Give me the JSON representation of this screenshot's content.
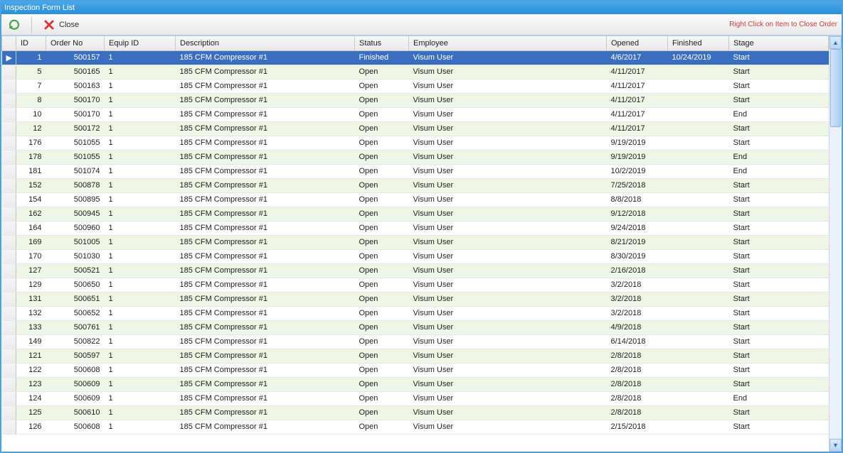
{
  "window": {
    "title": "Inspection Form List"
  },
  "toolbar": {
    "refresh_icon": "refresh-icon",
    "close_label": "Close",
    "hint": "Right Click on Item to Close Order"
  },
  "columns": {
    "rowhead": "",
    "id": "ID",
    "order_no": "Order No",
    "equip_id": "Equip ID",
    "description": "Description",
    "status": "Status",
    "employee": "Employee",
    "opened": "Opened",
    "finished": "Finished",
    "stage": "Stage"
  },
  "rows": [
    {
      "id": "1",
      "order_no": "500157",
      "equip_id": "1",
      "description": "185 CFM Compressor #1",
      "status": "Finished",
      "employee": "Visum User",
      "opened": "4/6/2017",
      "finished": "10/24/2019",
      "stage": "Start",
      "selected": true
    },
    {
      "id": "5",
      "order_no": "500165",
      "equip_id": "1",
      "description": "185 CFM Compressor #1",
      "status": "Open",
      "employee": "Visum User",
      "opened": "4/11/2017",
      "finished": "",
      "stage": "Start"
    },
    {
      "id": "7",
      "order_no": "500163",
      "equip_id": "1",
      "description": "185 CFM Compressor #1",
      "status": "Open",
      "employee": "Visum User",
      "opened": "4/11/2017",
      "finished": "",
      "stage": "Start"
    },
    {
      "id": "8",
      "order_no": "500170",
      "equip_id": "1",
      "description": "185 CFM Compressor #1",
      "status": "Open",
      "employee": "Visum User",
      "opened": "4/11/2017",
      "finished": "",
      "stage": "Start"
    },
    {
      "id": "10",
      "order_no": "500170",
      "equip_id": "1",
      "description": "185 CFM Compressor #1",
      "status": "Open",
      "employee": "Visum User",
      "opened": "4/11/2017",
      "finished": "",
      "stage": "End"
    },
    {
      "id": "12",
      "order_no": "500172",
      "equip_id": "1",
      "description": "185 CFM Compressor #1",
      "status": "Open",
      "employee": "Visum User",
      "opened": "4/11/2017",
      "finished": "",
      "stage": "Start"
    },
    {
      "id": "176",
      "order_no": "501055",
      "equip_id": "1",
      "description": "185 CFM Compressor #1",
      "status": "Open",
      "employee": "Visum User",
      "opened": "9/19/2019",
      "finished": "",
      "stage": "Start"
    },
    {
      "id": "178",
      "order_no": "501055",
      "equip_id": "1",
      "description": "185 CFM Compressor #1",
      "status": "Open",
      "employee": "Visum User",
      "opened": "9/19/2019",
      "finished": "",
      "stage": "End"
    },
    {
      "id": "181",
      "order_no": "501074",
      "equip_id": "1",
      "description": "185 CFM Compressor #1",
      "status": "Open",
      "employee": "Visum User",
      "opened": "10/2/2019",
      "finished": "",
      "stage": "End"
    },
    {
      "id": "152",
      "order_no": "500878",
      "equip_id": "1",
      "description": "185 CFM Compressor #1",
      "status": "Open",
      "employee": "Visum User",
      "opened": "7/25/2018",
      "finished": "",
      "stage": "Start"
    },
    {
      "id": "154",
      "order_no": "500895",
      "equip_id": "1",
      "description": "185 CFM Compressor #1",
      "status": "Open",
      "employee": "Visum User",
      "opened": "8/8/2018",
      "finished": "",
      "stage": "Start"
    },
    {
      "id": "162",
      "order_no": "500945",
      "equip_id": "1",
      "description": "185 CFM Compressor #1",
      "status": "Open",
      "employee": "Visum User",
      "opened": "9/12/2018",
      "finished": "",
      "stage": "Start"
    },
    {
      "id": "164",
      "order_no": "500960",
      "equip_id": "1",
      "description": "185 CFM Compressor #1",
      "status": "Open",
      "employee": "Visum User",
      "opened": "9/24/2018",
      "finished": "",
      "stage": "Start"
    },
    {
      "id": "169",
      "order_no": "501005",
      "equip_id": "1",
      "description": "185 CFM Compressor #1",
      "status": "Open",
      "employee": "Visum User",
      "opened": "8/21/2019",
      "finished": "",
      "stage": "Start"
    },
    {
      "id": "170",
      "order_no": "501030",
      "equip_id": "1",
      "description": "185 CFM Compressor #1",
      "status": "Open",
      "employee": "Visum User",
      "opened": "8/30/2019",
      "finished": "",
      "stage": "Start"
    },
    {
      "id": "127",
      "order_no": "500521",
      "equip_id": "1",
      "description": "185 CFM Compressor #1",
      "status": "Open",
      "employee": "Visum User",
      "opened": "2/16/2018",
      "finished": "",
      "stage": "Start"
    },
    {
      "id": "129",
      "order_no": "500650",
      "equip_id": "1",
      "description": "185 CFM Compressor #1",
      "status": "Open",
      "employee": "Visum User",
      "opened": "3/2/2018",
      "finished": "",
      "stage": "Start"
    },
    {
      "id": "131",
      "order_no": "500651",
      "equip_id": "1",
      "description": "185 CFM Compressor #1",
      "status": "Open",
      "employee": "Visum User",
      "opened": "3/2/2018",
      "finished": "",
      "stage": "Start"
    },
    {
      "id": "132",
      "order_no": "500652",
      "equip_id": "1",
      "description": "185 CFM Compressor #1",
      "status": "Open",
      "employee": "Visum User",
      "opened": "3/2/2018",
      "finished": "",
      "stage": "Start"
    },
    {
      "id": "133",
      "order_no": "500761",
      "equip_id": "1",
      "description": "185 CFM Compressor #1",
      "status": "Open",
      "employee": "Visum User",
      "opened": "4/9/2018",
      "finished": "",
      "stage": "Start"
    },
    {
      "id": "149",
      "order_no": "500822",
      "equip_id": "1",
      "description": "185 CFM Compressor #1",
      "status": "Open",
      "employee": "Visum User",
      "opened": "6/14/2018",
      "finished": "",
      "stage": "Start"
    },
    {
      "id": "121",
      "order_no": "500597",
      "equip_id": "1",
      "description": "185 CFM Compressor #1",
      "status": "Open",
      "employee": "Visum User",
      "opened": "2/8/2018",
      "finished": "",
      "stage": "Start"
    },
    {
      "id": "122",
      "order_no": "500608",
      "equip_id": "1",
      "description": "185 CFM Compressor #1",
      "status": "Open",
      "employee": "Visum User",
      "opened": "2/8/2018",
      "finished": "",
      "stage": "Start"
    },
    {
      "id": "123",
      "order_no": "500609",
      "equip_id": "1",
      "description": "185 CFM Compressor #1",
      "status": "Open",
      "employee": "Visum User",
      "opened": "2/8/2018",
      "finished": "",
      "stage": "Start"
    },
    {
      "id": "124",
      "order_no": "500609",
      "equip_id": "1",
      "description": "185 CFM Compressor #1",
      "status": "Open",
      "employee": "Visum User",
      "opened": "2/8/2018",
      "finished": "",
      "stage": "End"
    },
    {
      "id": "125",
      "order_no": "500610",
      "equip_id": "1",
      "description": "185 CFM Compressor #1",
      "status": "Open",
      "employee": "Visum User",
      "opened": "2/8/2018",
      "finished": "",
      "stage": "Start"
    },
    {
      "id": "126",
      "order_no": "500608",
      "equip_id": "1",
      "description": "185 CFM Compressor #1",
      "status": "Open",
      "employee": "Visum User",
      "opened": "2/15/2018",
      "finished": "",
      "stage": "Start"
    }
  ]
}
